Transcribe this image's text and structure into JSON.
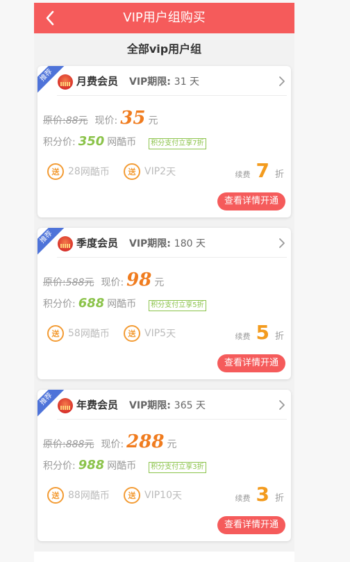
{
  "header": {
    "title": "VIP用户组购买"
  },
  "section": {
    "title": "全部vip用户组"
  },
  "labels": {
    "ribbon": "推荐",
    "period_prefix": "VIP期限: ",
    "day_unit": " 天",
    "old_price_prefix": "原价:",
    "yuan": "元",
    "now_label": "现价:",
    "points_label": "积分价:",
    "points_unit": "网酷币",
    "gift_icon": "送",
    "gift_points_unit": " 网酷币",
    "gift_vip_prefix": "VIP ",
    "renew_label": "续费",
    "discount_unit": "折",
    "detail_button": "查看详情开通"
  },
  "plans": [
    {
      "name": "月费会员",
      "period": "31",
      "old_price": "88",
      "price": "35",
      "points": "350",
      "points_tag": "积分支付立享7折",
      "gift_points": "28",
      "gift_vip_days": "2",
      "renew_discount": "7"
    },
    {
      "name": "季度会员",
      "period": "180",
      "old_price": "588",
      "price": "98",
      "points": "688",
      "points_tag": "积分支付立享5折",
      "gift_points": "58",
      "gift_vip_days": "5",
      "renew_discount": "5"
    },
    {
      "name": "年费会员",
      "period": "365",
      "old_price": "888",
      "price": "288",
      "points": "988",
      "points_tag": "积分支付立享3折",
      "gift_points": "88",
      "gift_vip_days": "10",
      "renew_discount": "3"
    }
  ],
  "colors": {
    "header_bg": "#f55b5b",
    "price": "#f07c1f",
    "points": "#8bc34a",
    "discount": "#f39b1e",
    "ribbon": "#4e73d9"
  }
}
